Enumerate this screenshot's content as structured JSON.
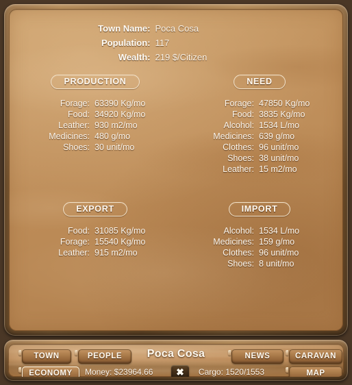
{
  "header": {
    "rows": [
      {
        "label": "Town Name:",
        "value": "Poca Cosa"
      },
      {
        "label": "Population:",
        "value": "117"
      },
      {
        "label": "Wealth:",
        "value": "219 $/Citizen"
      }
    ]
  },
  "sections": {
    "production": {
      "title": "PRODUCTION",
      "rows": [
        {
          "label": "Forage:",
          "value": "63390 Kg/mo"
        },
        {
          "label": "Food:",
          "value": "34920 Kg/mo"
        },
        {
          "label": "Leather:",
          "value": "930 m2/mo"
        },
        {
          "label": "Medicines:",
          "value": "480 g/mo"
        },
        {
          "label": "Shoes:",
          "value": "30 unit/mo"
        }
      ]
    },
    "need": {
      "title": "NEED",
      "rows": [
        {
          "label": "Forage:",
          "value": "47850 Kg/mo"
        },
        {
          "label": "Food:",
          "value": "3835 Kg/mo"
        },
        {
          "label": "Alcohol:",
          "value": "1534 L/mo"
        },
        {
          "label": "Medicines:",
          "value": "639 g/mo"
        },
        {
          "label": "Clothes:",
          "value": "96 unit/mo"
        },
        {
          "label": "Shoes:",
          "value": "38 unit/mo"
        },
        {
          "label": "Leather:",
          "value": "15 m2/mo"
        }
      ]
    },
    "export": {
      "title": "EXPORT",
      "rows": [
        {
          "label": "Food:",
          "value": "31085 Kg/mo"
        },
        {
          "label": "Forage:",
          "value": "15540 Kg/mo"
        },
        {
          "label": "Leather:",
          "value": "915 m2/mo"
        }
      ]
    },
    "import": {
      "title": "IMPORT",
      "rows": [
        {
          "label": "Alcohol:",
          "value": "1534 L/mo"
        },
        {
          "label": "Medicines:",
          "value": "159 g/mo"
        },
        {
          "label": "Clothes:",
          "value": "96 unit/mo"
        },
        {
          "label": "Shoes:",
          "value": "8 unit/mo"
        }
      ]
    }
  },
  "toolbar": {
    "town_label": "TOWN",
    "people_label": "PEOPLE",
    "news_label": "NEWS",
    "caravan_label": "CARAVAN",
    "economy_label": "ECONOMY",
    "map_label": "MAP",
    "town_title": "Poca Cosa",
    "money_text": "Money: $23964.66",
    "cargo_text": "Cargo: 1520/1553",
    "close_glyph": "✖"
  },
  "colors": {
    "panel_bg": "#c0905c",
    "frame": "#8e6436",
    "text": "#fdf7ee",
    "accent_border": "#f3e3cb"
  }
}
